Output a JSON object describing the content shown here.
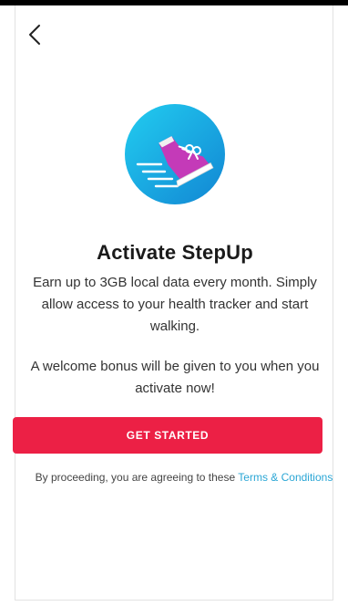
{
  "header": {
    "back_icon": "chevron-left-icon"
  },
  "hero": {
    "icon": "running-shoe-icon",
    "colors": {
      "circle_light": "#20c4ea",
      "circle_dark": "#138bd6",
      "shoe": "#c23bb6",
      "speed_lines": "#ffffff"
    }
  },
  "content": {
    "title": "Activate StepUp",
    "description": "Earn up to 3GB local data every month. Simply allow access to your health tracker and start walking.",
    "bonus_text": "A welcome bonus will be given to you when you activate now!"
  },
  "cta": {
    "label": "GET STARTED",
    "color": "#ec2045"
  },
  "footer": {
    "consent_text": "By proceeding, you are agreeing to these ",
    "terms_link": "Terms & Conditions",
    "link_color": "#2aa6d5"
  }
}
